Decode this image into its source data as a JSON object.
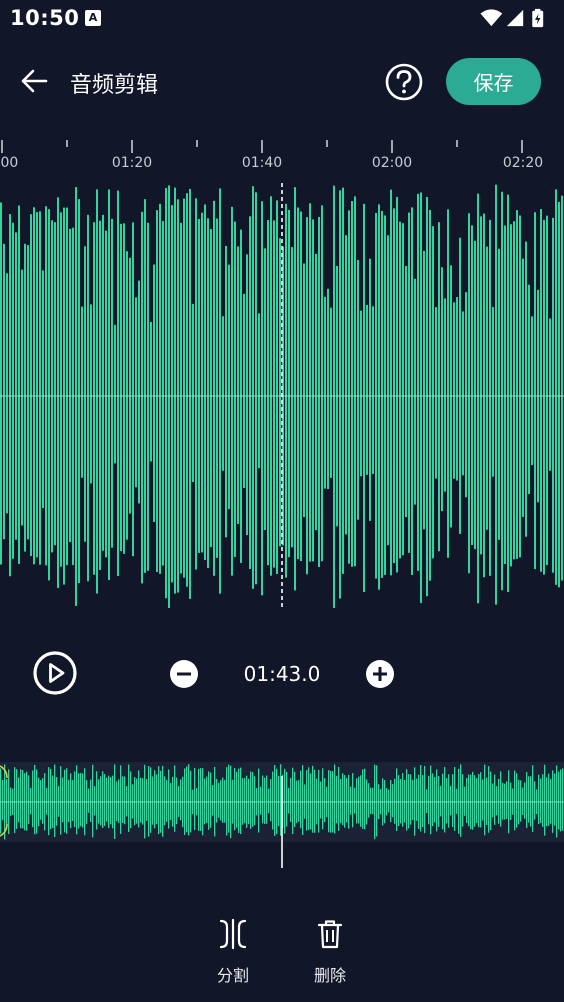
{
  "status_bar": {
    "time": "10:50",
    "app_icon_letter": "A",
    "icons": [
      "wifi-icon",
      "cellular-signal-icon",
      "battery-charging-icon"
    ]
  },
  "toolbar": {
    "back_icon": "arrow-left-icon",
    "title": "音频剪辑",
    "help_icon": "question-circle-icon",
    "save_label": "保存"
  },
  "timeline": {
    "tick_labels": [
      ":00",
      "01:20",
      "01:40",
      "02:00",
      "02:20"
    ]
  },
  "playback": {
    "current_time": "01:43.0",
    "play_icon": "play-circle-icon",
    "zoom_out_icon": "minus-circle-icon",
    "zoom_in_icon": "plus-circle-icon"
  },
  "tools": {
    "split_label": "分割",
    "split_icon": "split-icon",
    "delete_label": "删除",
    "delete_icon": "trash-icon"
  },
  "colors": {
    "background": "#121629",
    "accent": "#2bab93",
    "waveform": "#36d39f",
    "trim_handle": "#d4cf3a"
  }
}
